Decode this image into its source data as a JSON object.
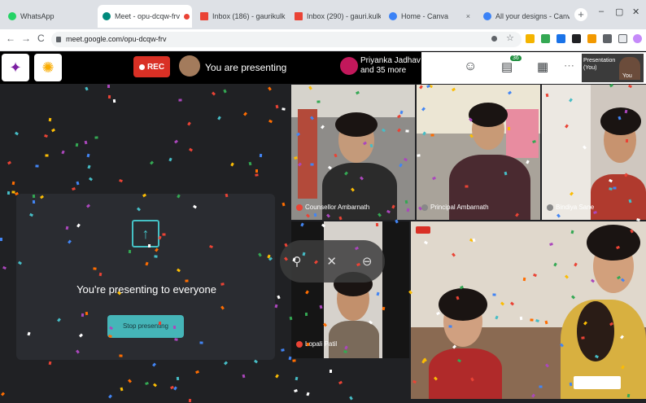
{
  "browser": {
    "tabs": [
      {
        "label": "WhatsApp",
        "color": "#25d366",
        "active": false
      },
      {
        "label": "Meet - opu-dcqw-frv",
        "color": "#00897b",
        "active": true
      },
      {
        "label": "Inbox (186) - gaurikulk",
        "color": "#ea4335",
        "active": false
      },
      {
        "label": "Inbox (290) - gauri.kulk",
        "color": "#ea4335",
        "active": false
      },
      {
        "label": "Home - Canva",
        "color": "#3b82f6",
        "active": false
      },
      {
        "label": "All your designs - Canva",
        "color": "#3b82f6",
        "active": false
      }
    ],
    "tab_close": "×",
    "new_tab": "+",
    "url": "meet.google.com/opu-dcqw-frv",
    "nav": {
      "back": "←",
      "forward": "→",
      "reload": "C"
    },
    "window_controls": {
      "minimize": "–",
      "restore": "▢",
      "close": "✕"
    }
  },
  "meet": {
    "rec_label": "REC",
    "presenting_label": "You are presenting",
    "participants_line1": "Priyanka Jadhav",
    "participants_line2": "and 35 more",
    "presentation_label_short": "Presentation",
    "presentation_label_short2": "(You)",
    "you_label": "You",
    "chat_badge": "36"
  },
  "presentation": {
    "message": "You're presenting to everyone",
    "stop_button": "Stop presenting"
  },
  "tiles": [
    {
      "name": "Counsellor Ambarnath"
    },
    {
      "name": "Principal Ambarnath"
    },
    {
      "name": "Bindiya Sane"
    },
    {
      "name": "Lopali Patil"
    }
  ],
  "colors": {
    "accent": "#45c1c5",
    "rec": "#d93025",
    "meet_bg": "#000000"
  }
}
